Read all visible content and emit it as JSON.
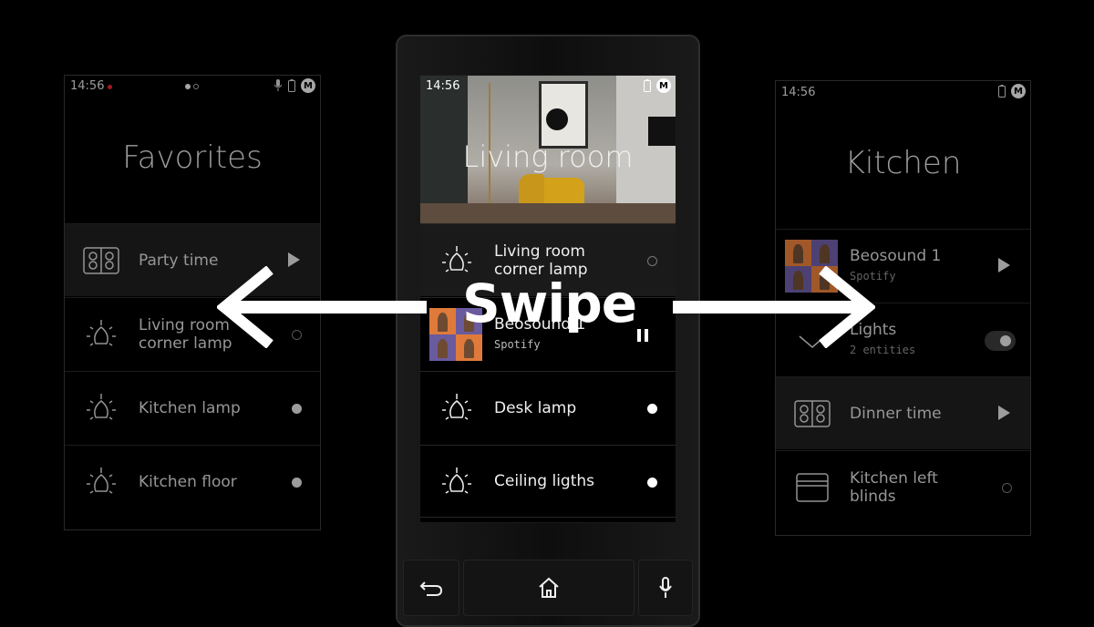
{
  "left_screen": {
    "status_time": "14:56",
    "title": "Favorites",
    "items": [
      {
        "label": "Party time",
        "icon": "speaker-icon",
        "control": "play"
      },
      {
        "label": "Living room corner lamp",
        "icon": "bulb-icon",
        "control": "off"
      },
      {
        "label": "Kitchen lamp",
        "icon": "bulb-icon",
        "control": "on"
      },
      {
        "label": "Kitchen floor",
        "icon": "bulb-icon",
        "control": "on"
      }
    ]
  },
  "center_screen": {
    "status_time": "14:56",
    "title": "Living room",
    "items": [
      {
        "label": "Living room corner lamp",
        "icon": "bulb-icon",
        "control": "off"
      },
      {
        "label": "Beosound 1",
        "sub": "Spotify",
        "icon": "album-art",
        "control": "pause"
      },
      {
        "label": "Desk lamp",
        "icon": "bulb-icon",
        "control": "on"
      },
      {
        "label": "Ceiling ligths",
        "icon": "bulb-icon",
        "control": "on"
      }
    ],
    "nav": [
      "back-icon",
      "home-icon",
      "microphone-icon"
    ]
  },
  "right_screen": {
    "status_time": "14:56",
    "title": "Kitchen",
    "items": [
      {
        "label": "Beosound 1",
        "sub": "Spotify",
        "icon": "album-art",
        "control": "play"
      },
      {
        "label": "Lights",
        "sub": "2 entities",
        "icon": "chevron-down-icon",
        "control": "toggle"
      },
      {
        "label": "Dinner time",
        "icon": "speaker-icon",
        "control": "play"
      },
      {
        "label": "Kitchen left blinds",
        "icon": "blinds-icon",
        "control": "off"
      }
    ]
  },
  "overlay": {
    "swipe_label": "Swipe"
  },
  "colors": {
    "background": "#000000",
    "highlight_row": "#1e1e1e",
    "record_dot": "#e0242b",
    "album_orange": "#e07a3a",
    "album_purple": "#6a5a9e"
  }
}
